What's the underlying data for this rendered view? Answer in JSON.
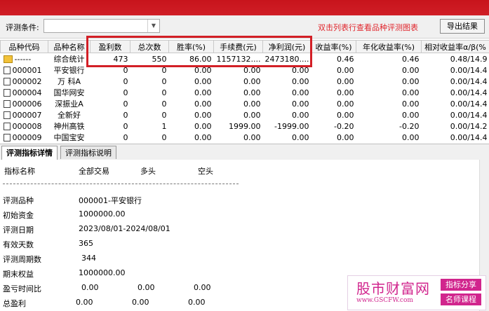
{
  "toolbar": {
    "condition_label": "评测条件:",
    "condition_value": "",
    "hint": "双击列表行查看品种评测图表",
    "export_label": "导出结果"
  },
  "grid": {
    "headers": [
      "品种代码",
      "品种名称",
      "盈利数",
      "总次数",
      "胜率(%)",
      "手续费(元)",
      "净利润(元)",
      "收益率(%)",
      "年化收益率(%)",
      "相对收益率α/β(%"
    ],
    "rows": [
      {
        "code": "------",
        "name": "综合统计",
        "win": "473",
        "total": "550",
        "rate": "86.00",
        "fee": "1157132....",
        "profit": "2473180....",
        "ret": "0.46",
        "annual": "0.46",
        "rel": "0.48/14.9"
      },
      {
        "code": "000001",
        "name": "平安银行",
        "win": "0",
        "total": "0",
        "rate": "0.00",
        "fee": "0.00",
        "profit": "0.00",
        "ret": "0.00",
        "annual": "0.00",
        "rel": "0.00/14.4"
      },
      {
        "code": "000002",
        "name": "万 科A",
        "win": "0",
        "total": "0",
        "rate": "0.00",
        "fee": "0.00",
        "profit": "0.00",
        "ret": "0.00",
        "annual": "0.00",
        "rel": "0.00/14.4"
      },
      {
        "code": "000004",
        "name": "国华网安",
        "win": "0",
        "total": "0",
        "rate": "0.00",
        "fee": "0.00",
        "profit": "0.00",
        "ret": "0.00",
        "annual": "0.00",
        "rel": "0.00/14.4"
      },
      {
        "code": "000006",
        "name": "深振业A",
        "win": "0",
        "total": "0",
        "rate": "0.00",
        "fee": "0.00",
        "profit": "0.00",
        "ret": "0.00",
        "annual": "0.00",
        "rel": "0.00/14.4"
      },
      {
        "code": "000007",
        "name": "全新好",
        "win": "0",
        "total": "0",
        "rate": "0.00",
        "fee": "0.00",
        "profit": "0.00",
        "ret": "0.00",
        "annual": "0.00",
        "rel": "0.00/14.4"
      },
      {
        "code": "000008",
        "name": "神州高铁",
        "win": "0",
        "total": "1",
        "rate": "0.00",
        "fee": "1999.00",
        "profit": "-1999.00",
        "ret": "-0.20",
        "annual": "-0.20",
        "rel": "0.00/14.2"
      },
      {
        "code": "000009",
        "name": "中国宝安",
        "win": "0",
        "total": "0",
        "rate": "0.00",
        "fee": "0.00",
        "profit": "0.00",
        "ret": "0.00",
        "annual": "0.00",
        "rel": "0.00/14.4"
      }
    ]
  },
  "tabs": [
    "评测指标详情",
    "评测指标说明"
  ],
  "detail": {
    "col_headers": [
      "指标名称",
      "全部交易",
      "多头",
      "空头"
    ],
    "items": [
      {
        "label": "评测品种",
        "v1": "000001-平安银行",
        "v2": "",
        "v3": ""
      },
      {
        "label": "初始资金",
        "v1": "1000000.00",
        "v2": "",
        "v3": ""
      },
      {
        "label": "评测日期",
        "v1": "2023/08/01-2024/08/01",
        "v2": "",
        "v3": ""
      },
      {
        "label": "有效天数",
        "v1": "365",
        "v2": "",
        "v3": ""
      },
      {
        "label": "评测周期数",
        "v1": "344",
        "v2": "",
        "v3": ""
      },
      {
        "label": "期末权益",
        "v1": "1000000.00",
        "v2": "",
        "v3": ""
      },
      {
        "label": "盈亏时间比",
        "v1": "0.00",
        "v2": "0.00",
        "v3": "0.00"
      },
      {
        "label": "总盈利",
        "v1": "0.00",
        "v2": "0.00",
        "v3": "0.00"
      }
    ]
  },
  "watermark": {
    "title": "股市财富网",
    "url": "www.GSCFW.com",
    "badge1": "指标分享",
    "badge2": "名师课程"
  }
}
